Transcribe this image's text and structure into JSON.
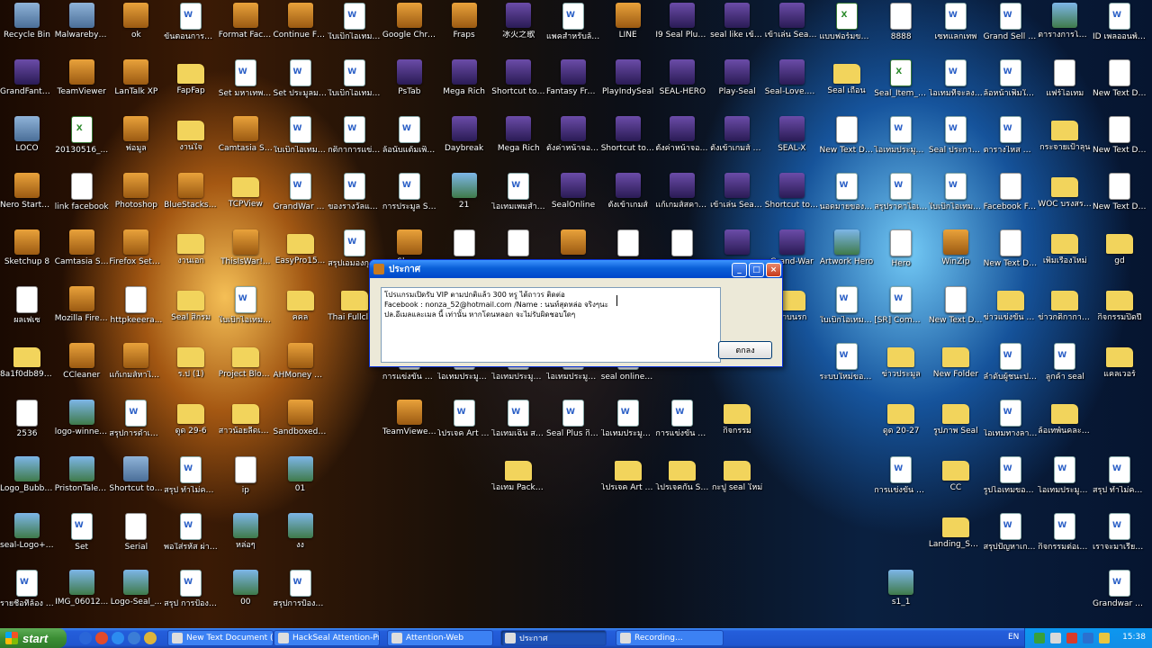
{
  "desktop_icons": [
    {
      "label": "Recycle Bin",
      "kind": "sys",
      "col": 0,
      "row": 0
    },
    {
      "label": "Malwarebytes Anti-Malware",
      "kind": "sys",
      "col": 1,
      "row": 0
    },
    {
      "label": "ok",
      "kind": "app",
      "col": 2,
      "row": 0
    },
    {
      "label": "ขั้นตอนการซื้อแพคไอเทม",
      "kind": "doc",
      "col": 3,
      "row": 0
    },
    {
      "label": "Format Factory",
      "kind": "app",
      "col": 4,
      "row": 0
    },
    {
      "label": "Continue FLV Player Ins...",
      "kind": "app",
      "col": 5,
      "row": 0
    },
    {
      "label": "ใบเบิกไอเทมประมูล",
      "kind": "doc",
      "col": 6,
      "row": 0
    },
    {
      "label": "Google Chrome",
      "kind": "app",
      "col": 7,
      "row": 0
    },
    {
      "label": "Fraps",
      "kind": "app",
      "col": 8,
      "row": 0
    },
    {
      "label": "冰火之歌",
      "kind": "game",
      "col": 9,
      "row": 0
    },
    {
      "label": "แพคสำหรับล้อนรับ ID ผู้...",
      "kind": "doc",
      "col": 10,
      "row": 0
    },
    {
      "label": "LINE",
      "kind": "app",
      "col": 11,
      "row": 0
    },
    {
      "label": "I9 Seal Plus Online",
      "kind": "game",
      "col": 12,
      "row": 0
    },
    {
      "label": "seal like เข้าเล่น",
      "kind": "game",
      "col": 13,
      "row": 0
    },
    {
      "label": "เข้าเล่น Seal-Loki",
      "kind": "game",
      "col": 14,
      "row": 0
    },
    {
      "label": "แบบฟอร์มขอSerial-SEAL",
      "kind": "excel",
      "col": 15,
      "row": 0
    },
    {
      "label": "8888",
      "kind": "txt",
      "col": 16,
      "row": 0
    },
    {
      "label": "เซทแลกเทพ",
      "kind": "doc",
      "col": 17,
      "row": 0
    },
    {
      "label": "Grand Sell ส่งท้าย",
      "kind": "doc",
      "col": 18,
      "row": 0
    },
    {
      "label": "ตารางการโหลดไนเน่อร์ตอนเน็ค",
      "kind": "img",
      "col": 19,
      "row": 0
    },
    {
      "label": "ID เพลออนพ์ลดลม",
      "kind": "doc",
      "col": 20,
      "row": 0
    },
    {
      "label": "GrandFantasia",
      "kind": "game",
      "col": 0,
      "row": 1
    },
    {
      "label": "TeamViewer",
      "kind": "app",
      "col": 1,
      "row": 1
    },
    {
      "label": "LanTalk XP",
      "kind": "app",
      "col": 2,
      "row": 1
    },
    {
      "label": "FapFap",
      "kind": "folder",
      "col": 3,
      "row": 1
    },
    {
      "label": "Set มหาเทพแก้ไข",
      "kind": "doc",
      "col": 4,
      "row": 1
    },
    {
      "label": "Set ประมูลมหาเทพ เซท ผ...",
      "kind": "doc",
      "col": 5,
      "row": 1
    },
    {
      "label": "ใบเบิกไอเทมเอมประมูล",
      "kind": "doc",
      "col": 6,
      "row": 1
    },
    {
      "label": "PsTab",
      "kind": "game",
      "col": 7,
      "row": 1
    },
    {
      "label": "Mega Rich",
      "kind": "game",
      "col": 8,
      "row": 1
    },
    {
      "label": "Shortcut to Launcher",
      "kind": "game",
      "col": 9,
      "row": 1
    },
    {
      "label": "Fantasy Frontier",
      "kind": "game",
      "col": 10,
      "row": 1
    },
    {
      "label": "PlayIndySeal",
      "kind": "game",
      "col": 11,
      "row": 1
    },
    {
      "label": "SEAL-HERO",
      "kind": "game",
      "col": 12,
      "row": 1
    },
    {
      "label": "Play-Seal",
      "kind": "game",
      "col": 13,
      "row": 1
    },
    {
      "label": "Seal-Love.exe",
      "kind": "game",
      "col": 14,
      "row": 1
    },
    {
      "label": "Seal เถื่อน",
      "kind": "folder",
      "col": 15,
      "row": 1
    },
    {
      "label": "Seal_Item_T... (ter)",
      "kind": "excel",
      "col": 16,
      "row": 1
    },
    {
      "label": "ไอเทมที่จะลงอาทิตย์หน้า",
      "kind": "doc",
      "col": 17,
      "row": 1
    },
    {
      "label": "ล้อหน้าเพิ่มในนับปีใหม่เอาไว้...",
      "kind": "doc",
      "col": 18,
      "row": 1
    },
    {
      "label": "แฟร์ไอเทม",
      "kind": "txt",
      "col": 19,
      "row": 1
    },
    {
      "label": "New Text Document (5)",
      "kind": "txt",
      "col": 20,
      "row": 1
    },
    {
      "label": "LOCO",
      "kind": "sys",
      "col": 0,
      "row": 2
    },
    {
      "label": "20130516_...",
      "kind": "excel",
      "col": 1,
      "row": 2
    },
    {
      "label": "พ่อมูล",
      "kind": "app",
      "col": 2,
      "row": 2
    },
    {
      "label": "งานใจ",
      "kind": "folder",
      "col": 3,
      "row": 2
    },
    {
      "label": "Camtasia Studio 8",
      "kind": "app",
      "col": 4,
      "row": 2
    },
    {
      "label": "ใบเบิกไอเทมประมูลใหม่",
      "kind": "doc",
      "col": 5,
      "row": 2
    },
    {
      "label": "กติกาการแข่งขัน",
      "kind": "doc",
      "col": 6,
      "row": 2
    },
    {
      "label": "ล้อนับแต้มเพิ่มของเล่น",
      "kind": "doc",
      "col": 7,
      "row": 2
    },
    {
      "label": "Daybreak",
      "kind": "game",
      "col": 8,
      "row": 2
    },
    {
      "label": "Mega Rich",
      "kind": "game",
      "col": 9,
      "row": 2
    },
    {
      "label": "ตั้งค่าหน้าจอเข้าเกมส์",
      "kind": "game",
      "col": 10,
      "row": 2
    },
    {
      "label": "Shortcut to AutoUpdate",
      "kind": "game",
      "col": 11,
      "row": 2
    },
    {
      "label": "ตั้งค่าหน้าจอ.exe",
      "kind": "game",
      "col": 12,
      "row": 2
    },
    {
      "label": "ตั้งเข้าเกมส์ Seal-Thor",
      "kind": "game",
      "col": 13,
      "row": 2
    },
    {
      "label": "SEAL-X",
      "kind": "game",
      "col": 14,
      "row": 2
    },
    {
      "label": "New Text Document (3)",
      "kind": "txt",
      "col": 15,
      "row": 2
    },
    {
      "label": "ไอเทมประมูลเซท(ใหม่)",
      "kind": "doc",
      "col": 16,
      "row": 2
    },
    {
      "label": "Seal ประกาศเติมหน้าสุมขั้น...",
      "kind": "doc",
      "col": 17,
      "row": 2
    },
    {
      "label": "ตารางไหส Winner...",
      "kind": "doc",
      "col": 18,
      "row": 2
    },
    {
      "label": "กระจายเป้าลุน",
      "kind": "folder",
      "col": 19,
      "row": 2
    },
    {
      "label": "New Text Document",
      "kind": "txt",
      "col": 20,
      "row": 2
    },
    {
      "label": "Nero StartSmart",
      "kind": "app",
      "col": 0,
      "row": 3
    },
    {
      "label": "link facebook",
      "kind": "txt",
      "col": 1,
      "row": 3
    },
    {
      "label": "Photoshop",
      "kind": "app",
      "col": 2,
      "row": 3
    },
    {
      "label": "BlueStacks-...",
      "kind": "app",
      "col": 3,
      "row": 3
    },
    {
      "label": "TCPView",
      "kind": "folder",
      "col": 4,
      "row": 3
    },
    {
      "label": "GrandWar เพิ่มค่าคิวกลางพลู...",
      "kind": "doc",
      "col": 5,
      "row": 3
    },
    {
      "label": "ของรางวัลและไอเทมไดโ...",
      "kind": "doc",
      "col": 6,
      "row": 3
    },
    {
      "label": "การประมูล Seal ข้อมูลลลงาน...",
      "kind": "doc",
      "col": 7,
      "row": 3
    },
    {
      "label": "21",
      "kind": "img",
      "col": 8,
      "row": 3
    },
    {
      "label": "ไอเทมเพมสำหรับผู้เล่นเล่น...",
      "kind": "doc",
      "col": 9,
      "row": 3
    },
    {
      "label": "SealOnline",
      "kind": "game",
      "col": 10,
      "row": 3
    },
    {
      "label": "ตั้งเข้าเกมส์",
      "kind": "game",
      "col": 11,
      "row": 3
    },
    {
      "label": "แก้เกมส์สคาดไม่โหลด",
      "kind": "game",
      "col": 12,
      "row": 3
    },
    {
      "label": "เข้าเล่น Seal-Luna",
      "kind": "game",
      "col": 13,
      "row": 3
    },
    {
      "label": "Shortcut to INBlack",
      "kind": "game",
      "col": 14,
      "row": 3
    },
    {
      "label": "นอดมายของไว้ยังคุรคะ",
      "kind": "doc",
      "col": 15,
      "row": 3
    },
    {
      "label": "สรุปราคาไอเทมพิเศษ",
      "kind": "doc",
      "col": 16,
      "row": 3
    },
    {
      "label": "ใบเบิกไอเทมเลือกกิจกร...",
      "kind": "doc",
      "col": 17,
      "row": 3
    },
    {
      "label": "Facebook Fan",
      "kind": "txt",
      "col": 18,
      "row": 3
    },
    {
      "label": "WOC บรงสรรพ",
      "kind": "folder",
      "col": 19,
      "row": 3
    },
    {
      "label": "New Text Document (2)",
      "kind": "txt",
      "col": 20,
      "row": 3
    },
    {
      "label": "Sketchup 8",
      "kind": "app",
      "col": 0,
      "row": 4
    },
    {
      "label": "Camtasia Studio 7",
      "kind": "app",
      "col": 1,
      "row": 4
    },
    {
      "label": "Firefox Setup 21.0",
      "kind": "app",
      "col": 2,
      "row": 4
    },
    {
      "label": "งานเอก",
      "kind": "folder",
      "col": 3,
      "row": 4
    },
    {
      "label": "ThisIsWar!...",
      "kind": "app",
      "col": 4,
      "row": 4
    },
    {
      "label": "EasyPro15...",
      "kind": "folder",
      "col": 5,
      "row": 4
    },
    {
      "label": "สรุปเอมองกุญแจลับ...",
      "kind": "doc",
      "col": 6,
      "row": 4
    },
    {
      "label": "Skype",
      "kind": "app",
      "col": 7,
      "row": 4
    },
    {
      "label": "",
      "kind": "txt",
      "col": 8,
      "row": 4
    },
    {
      "label": "",
      "kind": "txt",
      "col": 9,
      "row": 4
    },
    {
      "label": "",
      "kind": "app",
      "col": 10,
      "row": 4
    },
    {
      "label": "",
      "kind": "txt",
      "col": 11,
      "row": 4
    },
    {
      "label": "",
      "kind": "txt",
      "col": 12,
      "row": 4
    },
    {
      "label": "",
      "kind": "game",
      "col": 13,
      "row": 4
    },
    {
      "label": "Grand-War",
      "kind": "game",
      "col": 14,
      "row": 4
    },
    {
      "label": "Artwork Hero",
      "kind": "img",
      "col": 15,
      "row": 4
    },
    {
      "label": "Hero",
      "kind": "txt",
      "col": 16,
      "row": 4
    },
    {
      "label": "WinZip",
      "kind": "app",
      "col": 17,
      "row": 4
    },
    {
      "label": "New Text Document (6)",
      "kind": "txt",
      "col": 18,
      "row": 4
    },
    {
      "label": "เพิ่มเรื่องใหม่",
      "kind": "folder",
      "col": 19,
      "row": 4
    },
    {
      "label": "gd",
      "kind": "folder",
      "col": 20,
      "row": 4
    },
    {
      "label": "ผลเฟเซ",
      "kind": "txt",
      "col": 0,
      "row": 5
    },
    {
      "label": "Mozilla Firefox",
      "kind": "app",
      "col": 1,
      "row": 5
    },
    {
      "label": "httpkeeera...",
      "kind": "txt",
      "col": 2,
      "row": 5
    },
    {
      "label": "Seal สิกรม",
      "kind": "folder",
      "col": 3,
      "row": 5
    },
    {
      "label": "ใบเบิกไอเทมลกิจกรรมของรม...",
      "kind": "doc",
      "col": 4,
      "row": 5
    },
    {
      "label": "คคล",
      "kind": "folder",
      "col": 5,
      "row": 5
    },
    {
      "label": "Thai Fullclient",
      "kind": "folder",
      "col": 6,
      "row": 5
    },
    {
      "label": "ดาบนรก",
      "kind": "folder",
      "col": 14,
      "row": 5
    },
    {
      "label": "ใบเบิกไอเทมประมูล2",
      "kind": "doc",
      "col": 15,
      "row": 5
    },
    {
      "label": "[SR] Command",
      "kind": "doc",
      "col": 16,
      "row": 5
    },
    {
      "label": "New Text Document (4)",
      "kind": "txt",
      "col": 17,
      "row": 5
    },
    {
      "label": "ข่าวแข่งขัน TGC 2014",
      "kind": "folder",
      "col": 18,
      "row": 5
    },
    {
      "label": "ข่าวกติกาการประกวด TGC 2014",
      "kind": "folder",
      "col": 19,
      "row": 5
    },
    {
      "label": "กิจกรรมปิดปี",
      "kind": "folder",
      "col": 20,
      "row": 5
    },
    {
      "label": "8a1f0db898...",
      "kind": "folder",
      "col": 0,
      "row": 6
    },
    {
      "label": "CCleaner",
      "kind": "app",
      "col": 1,
      "row": 6
    },
    {
      "label": "แก้เกมส์หาไม่เจ็ดๆ",
      "kind": "app",
      "col": 2,
      "row": 6
    },
    {
      "label": "ร.ป (1)",
      "kind": "folder",
      "col": 3,
      "row": 6
    },
    {
      "label": "Project Block (ไปร seal",
      "kind": "folder",
      "col": 4,
      "row": 6
    },
    {
      "label": "AHMoney PRO v7.83",
      "kind": "app",
      "col": 5,
      "row": 6
    },
    {
      "label": "การแข่งขัน Legend of G...",
      "kind": "doc",
      "col": 7,
      "row": 6
    },
    {
      "label": "ไอเทมประมูลset Gambler",
      "kind": "doc",
      "col": 8,
      "row": 6
    },
    {
      "label": "ไอเทมประมูล set Assassin",
      "kind": "doc",
      "col": 9,
      "row": 6
    },
    {
      "label": "ไอเทมประมูล แซท",
      "kind": "doc",
      "col": 10,
      "row": 6
    },
    {
      "label": "seal online plus เพยไอเทมเปิ...",
      "kind": "doc",
      "col": 11,
      "row": 6
    },
    {
      "label": "ระบบใหม่ของไฟเทคีกซัน ส...",
      "kind": "doc",
      "col": 15,
      "row": 6
    },
    {
      "label": "ข่าวประมูล",
      "kind": "folder",
      "col": 16,
      "row": 6
    },
    {
      "label": "New Folder",
      "kind": "folder",
      "col": 17,
      "row": 6
    },
    {
      "label": "ลำดับผู้ชนะประมูล",
      "kind": "doc",
      "col": 18,
      "row": 6
    },
    {
      "label": "ลูกค้า seal",
      "kind": "doc",
      "col": 19,
      "row": 6
    },
    {
      "label": "แคลเวอร์",
      "kind": "folder",
      "col": 20,
      "row": 6
    },
    {
      "label": "2536",
      "kind": "txt",
      "col": 0,
      "row": 7
    },
    {
      "label": "logo-winner-02",
      "kind": "img",
      "col": 1,
      "row": 7
    },
    {
      "label": "สรุปการดำเนินการ Block 1...",
      "kind": "doc",
      "col": 2,
      "row": 7
    },
    {
      "label": "ดูด 29-6",
      "kind": "folder",
      "col": 3,
      "row": 7
    },
    {
      "label": "สาวน้อยลีดเด้ลseal เข้า",
      "kind": "folder",
      "col": 4,
      "row": 7
    },
    {
      "label": "Sandboxed Web Browser",
      "kind": "app",
      "col": 5,
      "row": 7
    },
    {
      "label": "TeamViewer 9",
      "kind": "app",
      "col": 7,
      "row": 7
    },
    {
      "label": "โปรเจค Art money pro...",
      "kind": "doc",
      "col": 8,
      "row": 7
    },
    {
      "label": "ไอเทมเฉิน สงคราม",
      "kind": "doc",
      "col": 9,
      "row": 7
    },
    {
      "label": "Seal Plus กิจกรรมแชร์...",
      "kind": "doc",
      "col": 10,
      "row": 7
    },
    {
      "label": "ไอเทมประมูล (สรุป)",
      "kind": "doc",
      "col": 11,
      "row": 7
    },
    {
      "label": "การแข่งขัน Legend of G...",
      "kind": "doc",
      "col": 12,
      "row": 7
    },
    {
      "label": "กิจกรรม",
      "kind": "folder",
      "col": 13,
      "row": 7
    },
    {
      "label": "ดูด 20-27",
      "kind": "folder",
      "col": 16,
      "row": 7
    },
    {
      "label": "รูปภาพ Seal",
      "kind": "folder",
      "col": 17,
      "row": 7
    },
    {
      "label": "ไอเทมทางลานประมูล",
      "kind": "doc",
      "col": 18,
      "row": 7
    },
    {
      "label": "ล้อเทพ์นคละเป็ค",
      "kind": "folder",
      "col": 19,
      "row": 7
    },
    {
      "label": "Logo_Bubble Diamond ...",
      "kind": "img",
      "col": 0,
      "row": 8
    },
    {
      "label": "PristonTale LOGO O...",
      "kind": "img",
      "col": 1,
      "row": 8
    },
    {
      "label": "Shortcut to My Computer",
      "kind": "sys",
      "col": 2,
      "row": 8
    },
    {
      "label": "สรุป ทำไม่คนถึงเล่น Ser...",
      "kind": "doc",
      "col": 3,
      "row": 8
    },
    {
      "label": "ip",
      "kind": "txt",
      "col": 4,
      "row": 8
    },
    {
      "label": "01",
      "kind": "img",
      "col": 5,
      "row": 8
    },
    {
      "label": "ไอเทม Pack ราคาพิเศษ ...",
      "kind": "folder",
      "col": 9,
      "row": 8
    },
    {
      "label": "โปรเจค Art money pro",
      "kind": "folder",
      "col": 11,
      "row": 8
    },
    {
      "label": "โปรเจคกัน Sanboxed",
      "kind": "folder",
      "col": 12,
      "row": 8
    },
    {
      "label": "กะปู seal ใหม่",
      "kind": "folder",
      "col": 13,
      "row": 8
    },
    {
      "label": "การแข่งขัน Legend of G...",
      "kind": "doc",
      "col": 16,
      "row": 8
    },
    {
      "label": "CC",
      "kind": "folder",
      "col": 17,
      "row": 8
    },
    {
      "label": "รูปไอเทมของประมูล ผู้เล่า",
      "kind": "doc",
      "col": 18,
      "row": 8
    },
    {
      "label": "ไอเทมประมูล (สรุป) ให้ลูกค้า",
      "kind": "doc",
      "col": 19,
      "row": 8
    },
    {
      "label": "สรุป ทำไม่คนถึงเล่น Ser...",
      "kind": "doc",
      "col": 20,
      "row": 8
    },
    {
      "label": "seal-Logo+url",
      "kind": "img",
      "col": 0,
      "row": 9
    },
    {
      "label": "Set",
      "kind": "doc",
      "col": 1,
      "row": 9
    },
    {
      "label": "Serial",
      "kind": "txt",
      "col": 2,
      "row": 9
    },
    {
      "label": "พอใส่รหัส ผ่านที่ สมัครใหม่แล้ว",
      "kind": "doc",
      "col": 3,
      "row": 9
    },
    {
      "label": "หล่อๆ",
      "kind": "img",
      "col": 4,
      "row": 9
    },
    {
      "label": "งง",
      "kind": "img",
      "col": 5,
      "row": 9
    },
    {
      "label": "Landing_Se...",
      "kind": "folder",
      "col": 17,
      "row": 9
    },
    {
      "label": "สรุปปัญหาเกมส์ Grandwar ...",
      "kind": "doc",
      "col": 18,
      "row": 9
    },
    {
      "label": "กิจกรรมต่อเนื่อง ต้อนรั...",
      "kind": "doc",
      "col": 19,
      "row": 9
    },
    {
      "label": "เราจะมาเรียนรู้เรื่องเค้าก้...",
      "kind": "doc",
      "col": 20,
      "row": 9
    },
    {
      "label": "รายชื่อที่ล้อง CC สรุปงาน",
      "kind": "doc",
      "col": 0,
      "row": 10
    },
    {
      "label": "IMG_06012...",
      "kind": "img",
      "col": 1,
      "row": 10
    },
    {
      "label": "Logo-Seal_...",
      "kind": "img",
      "col": 2,
      "row": 10
    },
    {
      "label": "สรุป การป้องกันโปรแกรม 2 ...",
      "kind": "doc",
      "col": 3,
      "row": 10
    },
    {
      "label": "00",
      "kind": "img",
      "col": 4,
      "row": 10
    },
    {
      "label": "สรุปการป้องกันโปรแกรม ช่...",
      "kind": "doc",
      "col": 5,
      "row": 10
    },
    {
      "label": "s1_1",
      "kind": "img",
      "col": 16,
      "row": 10
    },
    {
      "label": "Grandwar สุดยอด set อี...",
      "kind": "doc",
      "col": 20,
      "row": 10
    }
  ],
  "dialog": {
    "title": "ประกาศ",
    "message": "โปรแกรมเปิดรับ VIP ตามปกติแล้ว 300 ทรู ได้ถาวร ติดต่อ\nFacebook : nonza_52@hotmail.com /Name : นนท์สุดหล่อ จริงๆนะ\nปล.อีเมลและเมล นี้ เท่านั้น หากโดนหลอก จะไม่รับผิดชอบใดๆ",
    "ok_label": "ตกลง",
    "min_label": "_",
    "max_label": "□",
    "close_label": "×"
  },
  "taskbar": {
    "start_label": "start",
    "tasks": [
      {
        "label": "New Text Document (...",
        "active": false
      },
      {
        "label": "HackSeal Attention-Pro",
        "active": false
      },
      {
        "label": "Attention-Web",
        "active": false
      },
      {
        "label": "ประกาศ",
        "active": true
      },
      {
        "label": "Recording...",
        "active": false
      }
    ],
    "language": "EN",
    "clock": "15:38"
  }
}
